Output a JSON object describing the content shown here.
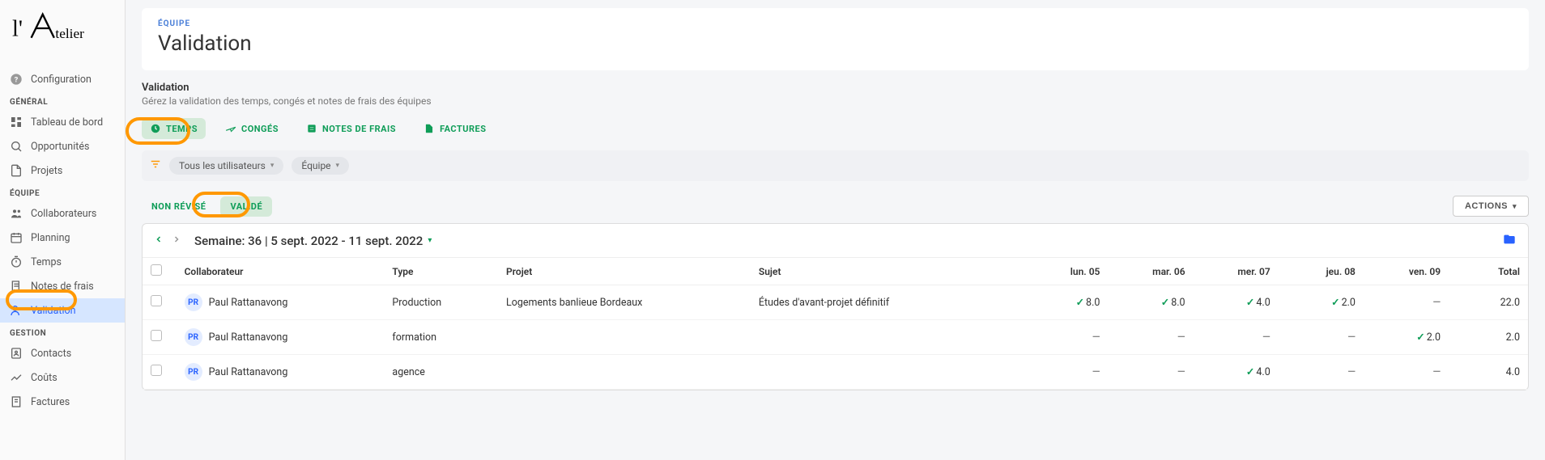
{
  "logo_text": "l'Atelier",
  "sidebar": {
    "config": "Configuration",
    "sections": [
      {
        "header": "GÉNÉRAL",
        "items": [
          {
            "icon": "dashboard-icon",
            "label": "Tableau de bord"
          },
          {
            "icon": "opportunities-icon",
            "label": "Opportunités"
          },
          {
            "icon": "projects-icon",
            "label": "Projets"
          }
        ]
      },
      {
        "header": "ÉQUIPE",
        "items": [
          {
            "icon": "users-icon",
            "label": "Collaborateurs"
          },
          {
            "icon": "calendar-icon",
            "label": "Planning"
          },
          {
            "icon": "timer-icon",
            "label": "Temps"
          },
          {
            "icon": "receipt-icon",
            "label": "Notes de frais"
          },
          {
            "icon": "user-check-icon",
            "label": "Validation",
            "active": true
          }
        ]
      },
      {
        "header": "GESTION",
        "items": [
          {
            "icon": "contacts-icon",
            "label": "Contacts"
          },
          {
            "icon": "chart-icon",
            "label": "Coûts"
          },
          {
            "icon": "invoice-icon",
            "label": "Factures"
          }
        ]
      }
    ]
  },
  "header": {
    "eyebrow": "ÉQUIPE",
    "title": "Validation"
  },
  "section": {
    "title": "Validation",
    "subtitle": "Gérez la validation des temps, congés et notes de frais des équipes"
  },
  "tabs": [
    {
      "icon": "clock-icon",
      "label": "TEMPS",
      "active": true
    },
    {
      "icon": "plane-icon",
      "label": "CONGÉS"
    },
    {
      "icon": "note-icon",
      "label": "NOTES DE FRAIS"
    },
    {
      "icon": "file-icon",
      "label": "FACTURES"
    }
  ],
  "filters": {
    "chip1": "Tous les utilisateurs",
    "chip2": "Équipe"
  },
  "subtabs": {
    "non_revise": "NON RÉVISÉ",
    "valide": "VALIDÉ",
    "actions": "ACTIONS"
  },
  "week": "Semaine: 36 | 5 sept. 2022 - 11 sept. 2022",
  "columns": {
    "collab": "Collaborateur",
    "type": "Type",
    "projet": "Projet",
    "sujet": "Sujet",
    "d1": "lun. 05",
    "d2": "mar. 06",
    "d3": "mer. 07",
    "d4": "jeu. 08",
    "d5": "ven. 09",
    "total": "Total"
  },
  "rows": [
    {
      "initials": "PR",
      "name": "Paul Rattanavong",
      "type": "Production",
      "projet": "Logements banlieue Bordeaux",
      "sujet": "Études d'avant-projet définitif",
      "d1": {
        "v": "8.0",
        "ok": true
      },
      "d2": {
        "v": "8.0",
        "ok": true
      },
      "d3": {
        "v": "4.0",
        "ok": true
      },
      "d4": {
        "v": "2.0",
        "ok": true
      },
      "d5": {
        "v": "—",
        "ok": false
      },
      "total": "22.0"
    },
    {
      "initials": "PR",
      "name": "Paul Rattanavong",
      "type": "formation",
      "projet": "",
      "sujet": "",
      "d1": {
        "v": "—",
        "ok": false
      },
      "d2": {
        "v": "—",
        "ok": false
      },
      "d3": {
        "v": "—",
        "ok": false
      },
      "d4": {
        "v": "—",
        "ok": false
      },
      "d5": {
        "v": "2.0",
        "ok": true
      },
      "total": "2.0"
    },
    {
      "initials": "PR",
      "name": "Paul Rattanavong",
      "type": "agence",
      "projet": "",
      "sujet": "",
      "d1": {
        "v": "—",
        "ok": false
      },
      "d2": {
        "v": "—",
        "ok": false
      },
      "d3": {
        "v": "4.0",
        "ok": true
      },
      "d4": {
        "v": "—",
        "ok": false
      },
      "d5": {
        "v": "—",
        "ok": false
      },
      "total": "4.0"
    }
  ]
}
